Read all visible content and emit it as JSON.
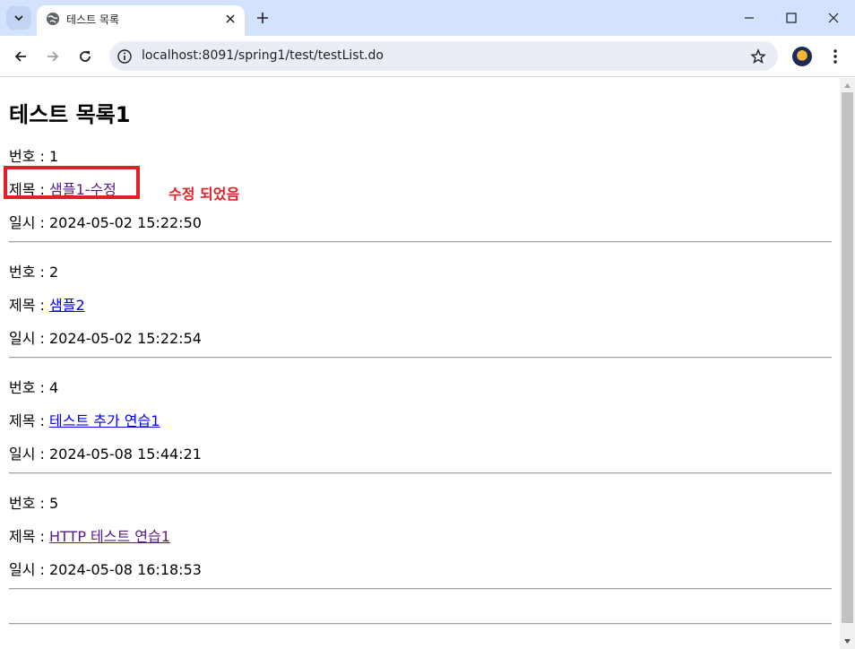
{
  "browser": {
    "tab_title": "테스트 목록",
    "url": "localhost:8091/spring1/test/testList.do"
  },
  "page": {
    "title": "테스트 목록1",
    "records": [
      {
        "no_line": "번호 : 1",
        "title_prefix": "제목 : ",
        "title_link": "샘플1-수정",
        "date_line": "일시 : 2024-05-02 15:22:50",
        "visited": true
      },
      {
        "no_line": "번호 : 2",
        "title_prefix": "제목 : ",
        "title_link": "샘플2",
        "date_line": "일시 : 2024-05-02 15:22:54",
        "visited": false
      },
      {
        "no_line": "번호 : 4",
        "title_prefix": "제목 : ",
        "title_link": "테스트 추가 연습1",
        "date_line": "일시 : 2024-05-08 15:44:21",
        "visited": false
      },
      {
        "no_line": "번호 : 5",
        "title_prefix": "제목 : ",
        "title_link": "HTTP 테스트 연습1",
        "date_line": "일시 : 2024-05-08 16:18:53",
        "visited": true
      }
    ],
    "annotation": "수정 되었음"
  },
  "colors": {
    "annotation": "#e11f26",
    "link_unvisited": "#0000ee",
    "link_visited": "#551a8b",
    "tabstrip": "#d3e3fd"
  }
}
